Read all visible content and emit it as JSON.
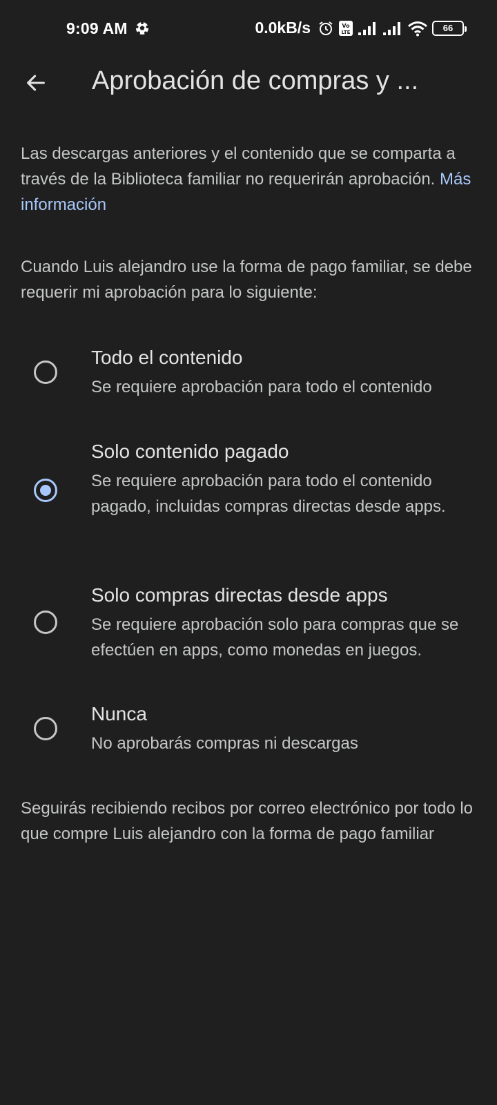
{
  "status_bar": {
    "time": "9:09 AM",
    "net_speed": "0.0kB/s",
    "battery": "66",
    "icons": [
      "soccer-ball-icon",
      "alarm-icon",
      "volte-icon",
      "signal-icon",
      "signal-icon",
      "wifi-icon",
      "battery-icon"
    ]
  },
  "header": {
    "back_icon": "arrow-left-icon",
    "title": "Aprobación de compras y ..."
  },
  "intro": {
    "text": "Las descargas anteriores y el contenido que se comparta a través de la Biblioteca familiar no requerirán aprobación. ",
    "link": "Más información"
  },
  "question": "Cuando Luis alejandro use la forma de pago familiar, se debe requerir mi aprobación para lo siguiente:",
  "options": [
    {
      "title": "Todo el contenido",
      "description": "Se requiere aprobación para todo el contenido",
      "selected": false
    },
    {
      "title": "Solo contenido pagado",
      "description": "Se requiere aprobación para todo el contenido pagado, incluidas compras directas desde apps.",
      "selected": true
    },
    {
      "title": "Solo compras directas desde apps",
      "description": "Se requiere aprobación solo para compras que se efectúen en apps, como monedas en juegos.",
      "selected": false
    },
    {
      "title": "Nunca",
      "description": "No aprobarás compras ni descargas",
      "selected": false
    }
  ],
  "footer": "Seguirás recibiendo recibos por correo electrónico por todo lo que compre Luis alejandro con la forma de pago familiar",
  "colors": {
    "background": "#1f1f1f",
    "accent": "#a8c7fa",
    "primary_text": "#e3e3e3",
    "secondary_text": "#c4c7c5"
  }
}
